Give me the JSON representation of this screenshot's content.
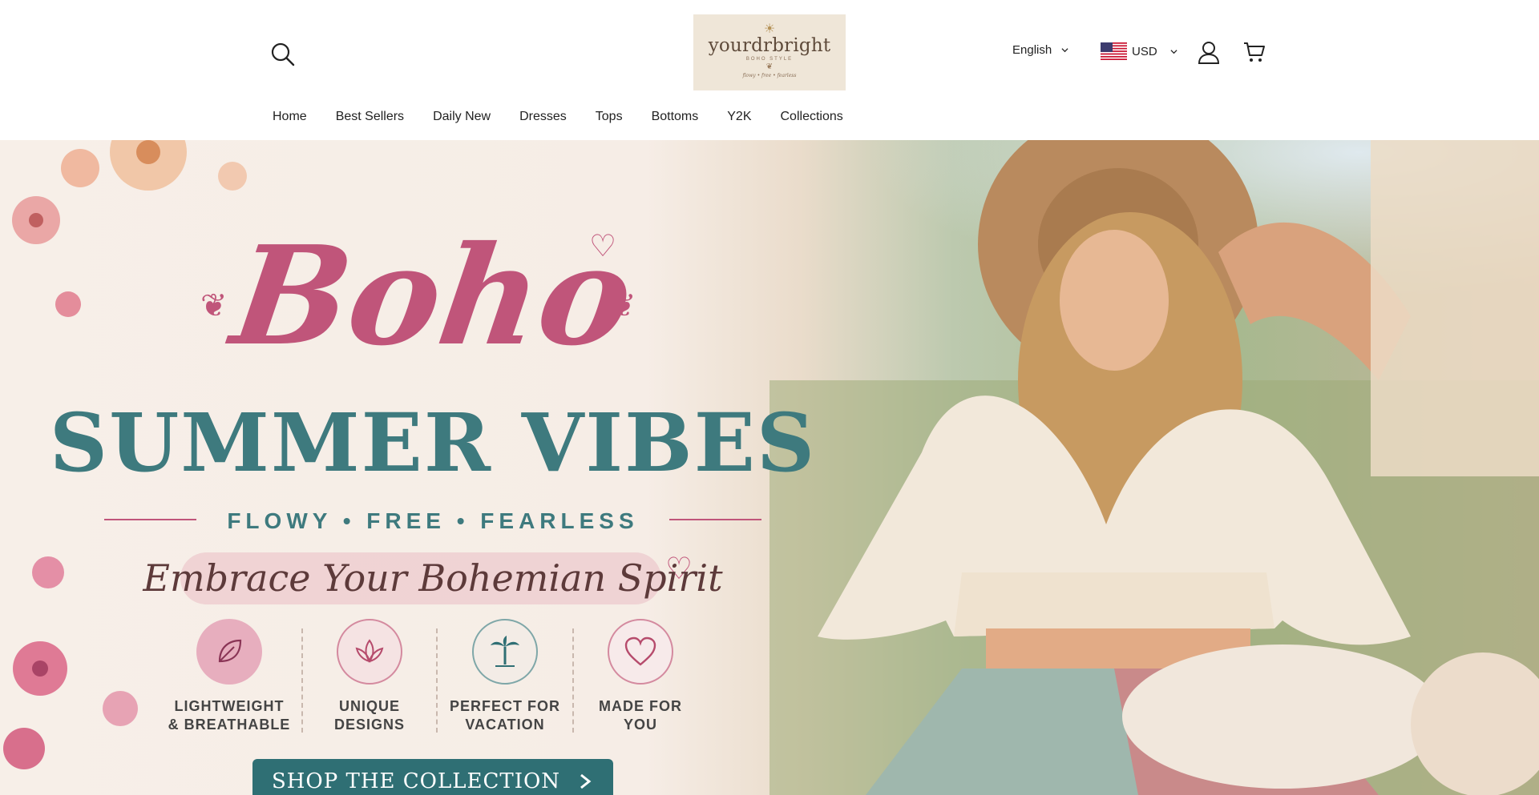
{
  "header": {
    "logo": {
      "name": "yourdrbright",
      "subtitle": "BOHO STYLE",
      "tagline": "flowy • free • fearless"
    },
    "language": "English",
    "currency": "USD"
  },
  "nav": {
    "items": [
      "Home",
      "Best Sellers",
      "Daily New",
      "Dresses",
      "Tops",
      "Bottoms",
      "Y2K",
      "Collections"
    ]
  },
  "hero": {
    "title_script": "Boho",
    "title_main": "SUMMER VIBES",
    "tagline": "FLOWY • FREE • FEARLESS",
    "subtitle": "Embrace Your Bohemian Spirit",
    "features": [
      {
        "label": "LIGHTWEIGHT\n& BREATHABLE",
        "icon": "leaf-icon"
      },
      {
        "label": "UNIQUE\nDESIGNS",
        "icon": "lotus-icon"
      },
      {
        "label": "PERFECT FOR\nVACATION",
        "icon": "palm-tree-icon"
      },
      {
        "label": "MADE FOR\nYOU",
        "icon": "heart-icon"
      }
    ],
    "cta": "SHOP THE COLLECTION"
  },
  "colors": {
    "pink": "#c0557a",
    "teal": "#3e7a7e",
    "button": "#2f6f74"
  }
}
